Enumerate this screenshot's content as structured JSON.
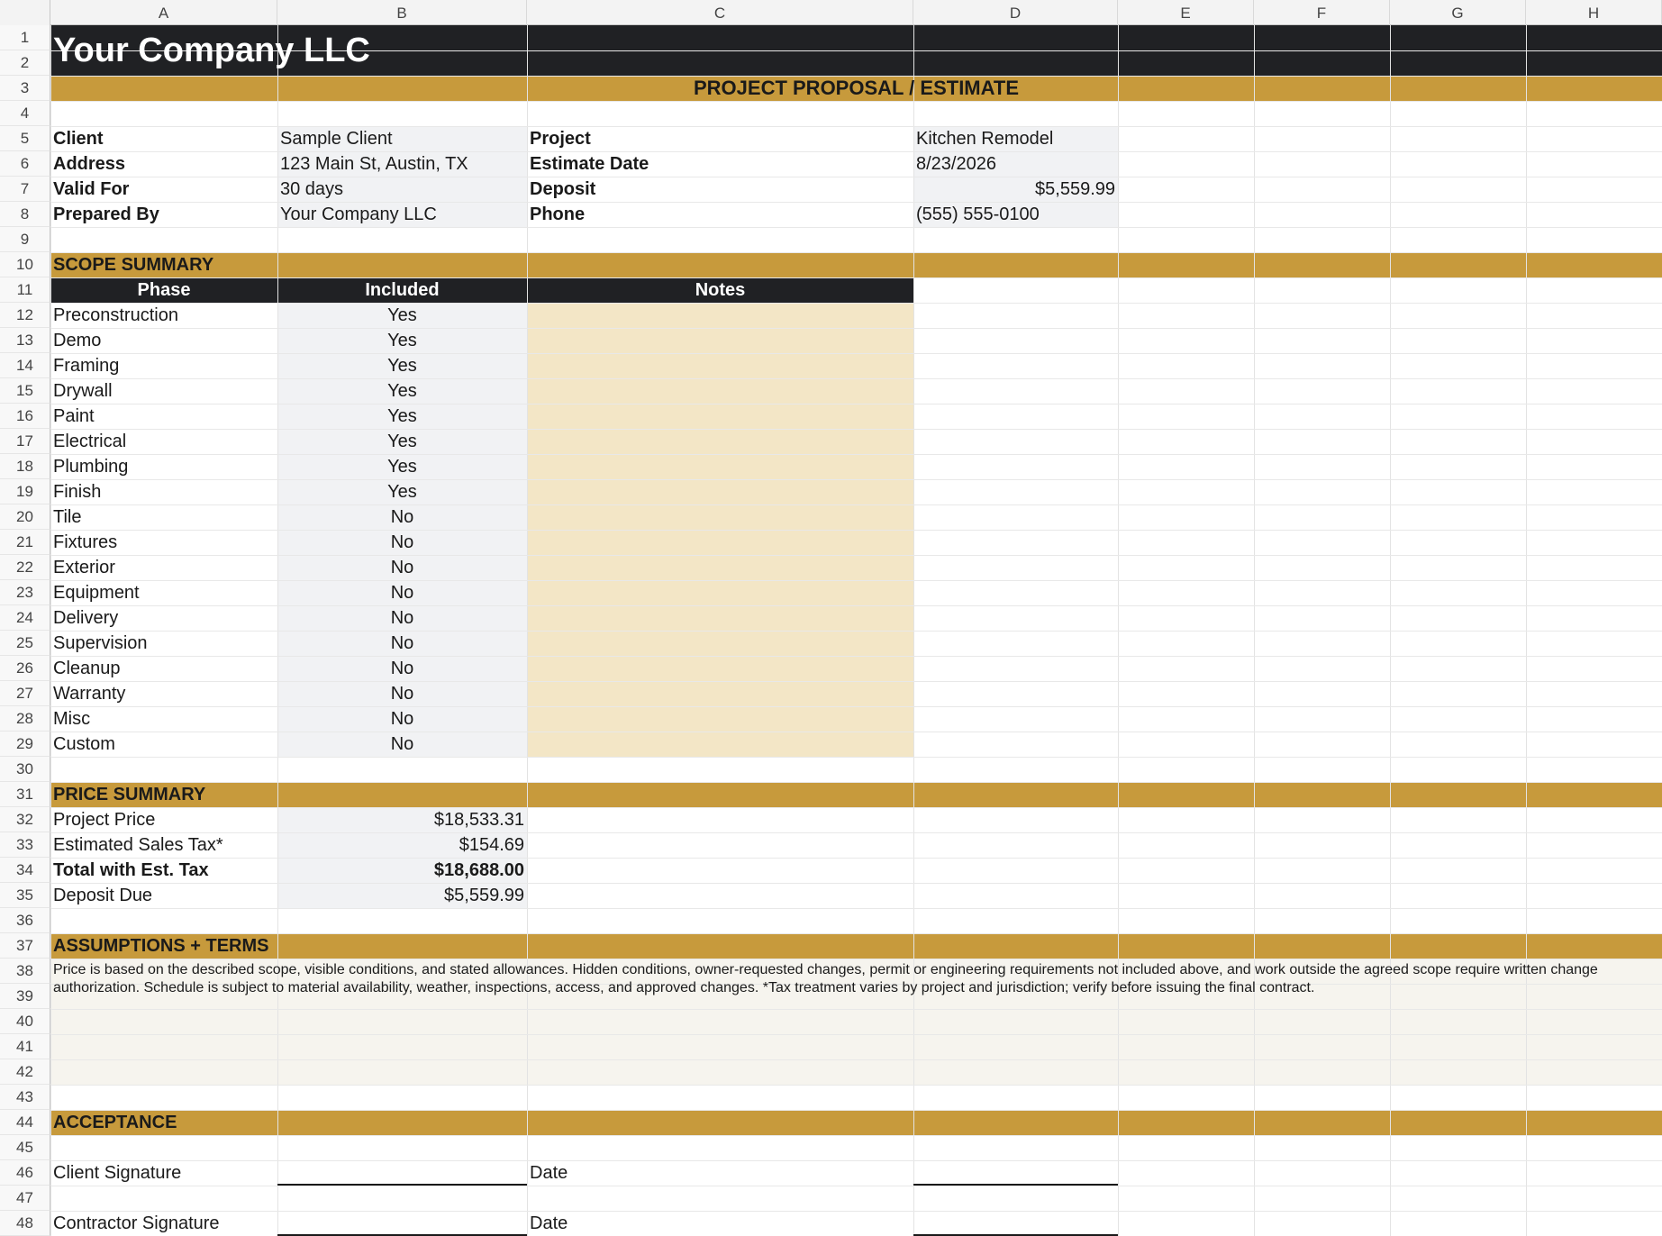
{
  "columns": [
    "A",
    "B",
    "C",
    "D",
    "E",
    "F",
    "G",
    "H"
  ],
  "rows": [
    "1",
    "2",
    "3",
    "4",
    "5",
    "6",
    "7",
    "8",
    "9",
    "10",
    "11",
    "12",
    "13",
    "14",
    "15",
    "16",
    "17",
    "18",
    "19",
    "20",
    "21",
    "22",
    "23",
    "24",
    "25",
    "26",
    "27",
    "28",
    "29",
    "30",
    "31",
    "32",
    "33",
    "34",
    "35",
    "36",
    "37",
    "38",
    "39",
    "40",
    "41",
    "42",
    "43",
    "44",
    "45",
    "46",
    "47",
    "48"
  ],
  "header": {
    "company": "Your Company LLC",
    "subtitle": "PROJECT PROPOSAL / ESTIMATE"
  },
  "info": {
    "client_label": "Client",
    "client_value": "Sample Client",
    "address_label": "Address",
    "address_value": "123 Main St, Austin, TX",
    "valid_label": "Valid For",
    "valid_value": "30 days",
    "prepared_label": "Prepared By",
    "prepared_value": "Your Company LLC",
    "project_label": "Project",
    "project_value": "Kitchen Remodel",
    "date_label": "Estimate Date",
    "date_value": "8/23/2026",
    "deposit_label": "Deposit",
    "deposit_value": "$5,559.99",
    "phone_label": "Phone",
    "phone_value": "(555) 555-0100"
  },
  "scope": {
    "title": "SCOPE SUMMARY",
    "col_phase": "Phase",
    "col_included": "Included",
    "col_notes": "Notes",
    "phases": [
      {
        "name": "Preconstruction",
        "included": "Yes"
      },
      {
        "name": "Demo",
        "included": "Yes"
      },
      {
        "name": "Framing",
        "included": "Yes"
      },
      {
        "name": "Drywall",
        "included": "Yes"
      },
      {
        "name": "Paint",
        "included": "Yes"
      },
      {
        "name": "Electrical",
        "included": "Yes"
      },
      {
        "name": "Plumbing",
        "included": "Yes"
      },
      {
        "name": "Finish",
        "included": "Yes"
      },
      {
        "name": "Tile",
        "included": "No"
      },
      {
        "name": "Fixtures",
        "included": "No"
      },
      {
        "name": "Exterior",
        "included": "No"
      },
      {
        "name": "Equipment",
        "included": "No"
      },
      {
        "name": "Delivery",
        "included": "No"
      },
      {
        "name": "Supervision",
        "included": "No"
      },
      {
        "name": "Cleanup",
        "included": "No"
      },
      {
        "name": "Warranty",
        "included": "No"
      },
      {
        "name": "Misc",
        "included": "No"
      },
      {
        "name": "Custom",
        "included": "No"
      }
    ]
  },
  "price": {
    "title": "PRICE SUMMARY",
    "project_price_label": "Project Price",
    "project_price_value": "$18,533.31",
    "tax_label": "Estimated Sales Tax*",
    "tax_value": "$154.69",
    "total_label": "Total with Est. Tax",
    "total_value": "$18,688.00",
    "deposit_due_label": "Deposit Due",
    "deposit_due_value": "$5,559.99"
  },
  "terms": {
    "title": "ASSUMPTIONS + TERMS",
    "text": "Price is based on the described scope, visible conditions, and stated allowances. Hidden conditions, owner-requested changes, permit or engineering requirements not included above, and work outside the agreed scope require written change authorization. Schedule is subject to material availability, weather, inspections, access, and approved changes. *Tax treatment varies by project and jurisdiction; verify before issuing the final contract."
  },
  "acceptance": {
    "title": "ACCEPTANCE",
    "client_sig_label": "Client Signature",
    "contractor_sig_label": "Contractor Signature",
    "date_label_1": "Date",
    "date_label_2": "Date"
  },
  "colors": {
    "dark_band": "#202124",
    "gold_band": "#c79a3c",
    "input_gray": "#f1f2f4",
    "notes_tan": "#f3e6c6",
    "terms_cream": "#f6f4ee"
  }
}
